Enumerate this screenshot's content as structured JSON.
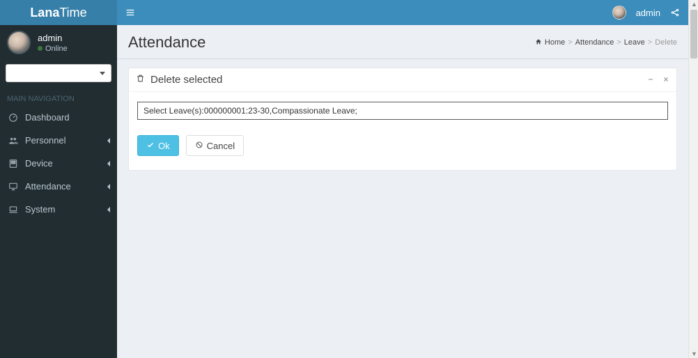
{
  "brand": {
    "bold": "Lana",
    "rest": "Time"
  },
  "sidebar": {
    "user": {
      "name": "admin",
      "status": "Online"
    },
    "nav_header": "MAIN NAVIGATION",
    "items": [
      {
        "label": "Dashboard",
        "icon": "dashboard",
        "expandable": false
      },
      {
        "label": "Personnel",
        "icon": "users",
        "expandable": true
      },
      {
        "label": "Device",
        "icon": "device",
        "expandable": true
      },
      {
        "label": "Attendance",
        "icon": "monitor",
        "expandable": true
      },
      {
        "label": "System",
        "icon": "laptop",
        "expandable": true
      }
    ]
  },
  "topbar": {
    "user": "admin"
  },
  "header": {
    "title": "Attendance",
    "breadcrumb": {
      "home": "Home",
      "crumb1": "Attendance",
      "crumb2": "Leave",
      "current": "Delete"
    }
  },
  "box": {
    "title": "Delete selected",
    "selection_text": "Select Leave(s):000000001:23-30,Compassionate Leave;",
    "ok_label": "Ok",
    "cancel_label": "Cancel"
  }
}
